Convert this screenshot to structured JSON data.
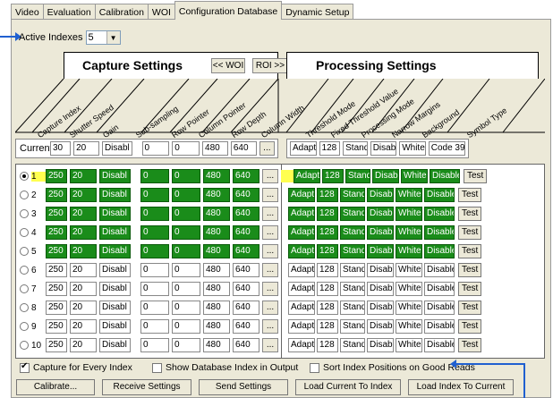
{
  "tabs": [
    "Video",
    "Evaluation",
    "Calibration",
    "WOI",
    "Configuration Database",
    "Dynamic Setup"
  ],
  "active_indexes": {
    "label": "Active Indexes",
    "value": "5"
  },
  "capture": {
    "title": "Capture Settings",
    "woi_btn": "<< WOI",
    "roi_btn": "ROI >>",
    "columns": [
      "Capture Index",
      "Shutter Speed",
      "Gain",
      "Sub-sampling",
      "Row Pointer",
      "Column Pointer",
      "Row Depth",
      "Column Width"
    ]
  },
  "processing": {
    "title": "Processing Settings",
    "columns": [
      "Threshold Mode",
      "Fixed Threshold Value",
      "Processing Mode",
      "Narrow Margins",
      "Background",
      "Symbol Type"
    ]
  },
  "current": {
    "label": "Current",
    "cap": [
      "30",
      "20",
      "Disabl",
      "0",
      "0",
      "480",
      "640"
    ],
    "proc": [
      "Adapti",
      "128",
      "Stand",
      "Disabl",
      "White",
      "Code 39"
    ]
  },
  "rows": [
    {
      "idx": "1",
      "cap": [
        "250",
        "20",
        "Disabl",
        "0",
        "0",
        "480",
        "640"
      ],
      "proc": [
        "Adapti",
        "128",
        "Stand",
        "Disabl",
        "White",
        "Disabled"
      ]
    },
    {
      "idx": "2",
      "cap": [
        "250",
        "20",
        "Disabl",
        "0",
        "0",
        "480",
        "640"
      ],
      "proc": [
        "Adapti",
        "128",
        "Stand",
        "Disabl",
        "White",
        "Disabled"
      ]
    },
    {
      "idx": "3",
      "cap": [
        "250",
        "20",
        "Disabl",
        "0",
        "0",
        "480",
        "640"
      ],
      "proc": [
        "Adapti",
        "128",
        "Stand",
        "Disabl",
        "White",
        "Disabled"
      ]
    },
    {
      "idx": "4",
      "cap": [
        "250",
        "20",
        "Disabl",
        "0",
        "0",
        "480",
        "640"
      ],
      "proc": [
        "Adapti",
        "128",
        "Stand",
        "Disabl",
        "White",
        "Disabled"
      ]
    },
    {
      "idx": "5",
      "cap": [
        "250",
        "20",
        "Disabl",
        "0",
        "0",
        "480",
        "640"
      ],
      "proc": [
        "Adapti",
        "128",
        "Stand",
        "Disabl",
        "White",
        "Disabled"
      ]
    },
    {
      "idx": "6",
      "cap": [
        "250",
        "20",
        "Disabl",
        "0",
        "0",
        "480",
        "640"
      ],
      "proc": [
        "Adapti",
        "128",
        "Stand",
        "Disabl",
        "White",
        "Disabled"
      ]
    },
    {
      "idx": "7",
      "cap": [
        "250",
        "20",
        "Disabl",
        "0",
        "0",
        "480",
        "640"
      ],
      "proc": [
        "Adapti",
        "128",
        "Stand",
        "Disabl",
        "White",
        "Disabled"
      ]
    },
    {
      "idx": "8",
      "cap": [
        "250",
        "20",
        "Disabl",
        "0",
        "0",
        "480",
        "640"
      ],
      "proc": [
        "Adapti",
        "128",
        "Stand",
        "Disabl",
        "White",
        "Disabled"
      ]
    },
    {
      "idx": "9",
      "cap": [
        "250",
        "20",
        "Disabl",
        "0",
        "0",
        "480",
        "640"
      ],
      "proc": [
        "Adapti",
        "128",
        "Stand",
        "Disabl",
        "White",
        "Disabled"
      ]
    },
    {
      "idx": "10",
      "cap": [
        "250",
        "20",
        "Disabl",
        "0",
        "0",
        "480",
        "640"
      ],
      "proc": [
        "Adapti",
        "128",
        "Stand",
        "Disabl",
        "White",
        "Disabled"
      ]
    }
  ],
  "active_count": 5,
  "selected_index": 1,
  "test_label": "Test",
  "ellipsis": "...",
  "options": {
    "capture_every": "Capture for Every Index",
    "show_db_index": "Show Database Index in Output",
    "sort_positions": "Sort Index Positions on Good Reads"
  },
  "buttons": {
    "calibrate": "Calibrate...",
    "receive": "Receive Settings",
    "send": "Send Settings",
    "load_current": "Load Current To Index",
    "load_index": "Load Index To Current"
  },
  "colors": {
    "active_field": "#1a8c1a",
    "highlight": "#ffff50",
    "annotation_arrow": "#2060d0"
  }
}
